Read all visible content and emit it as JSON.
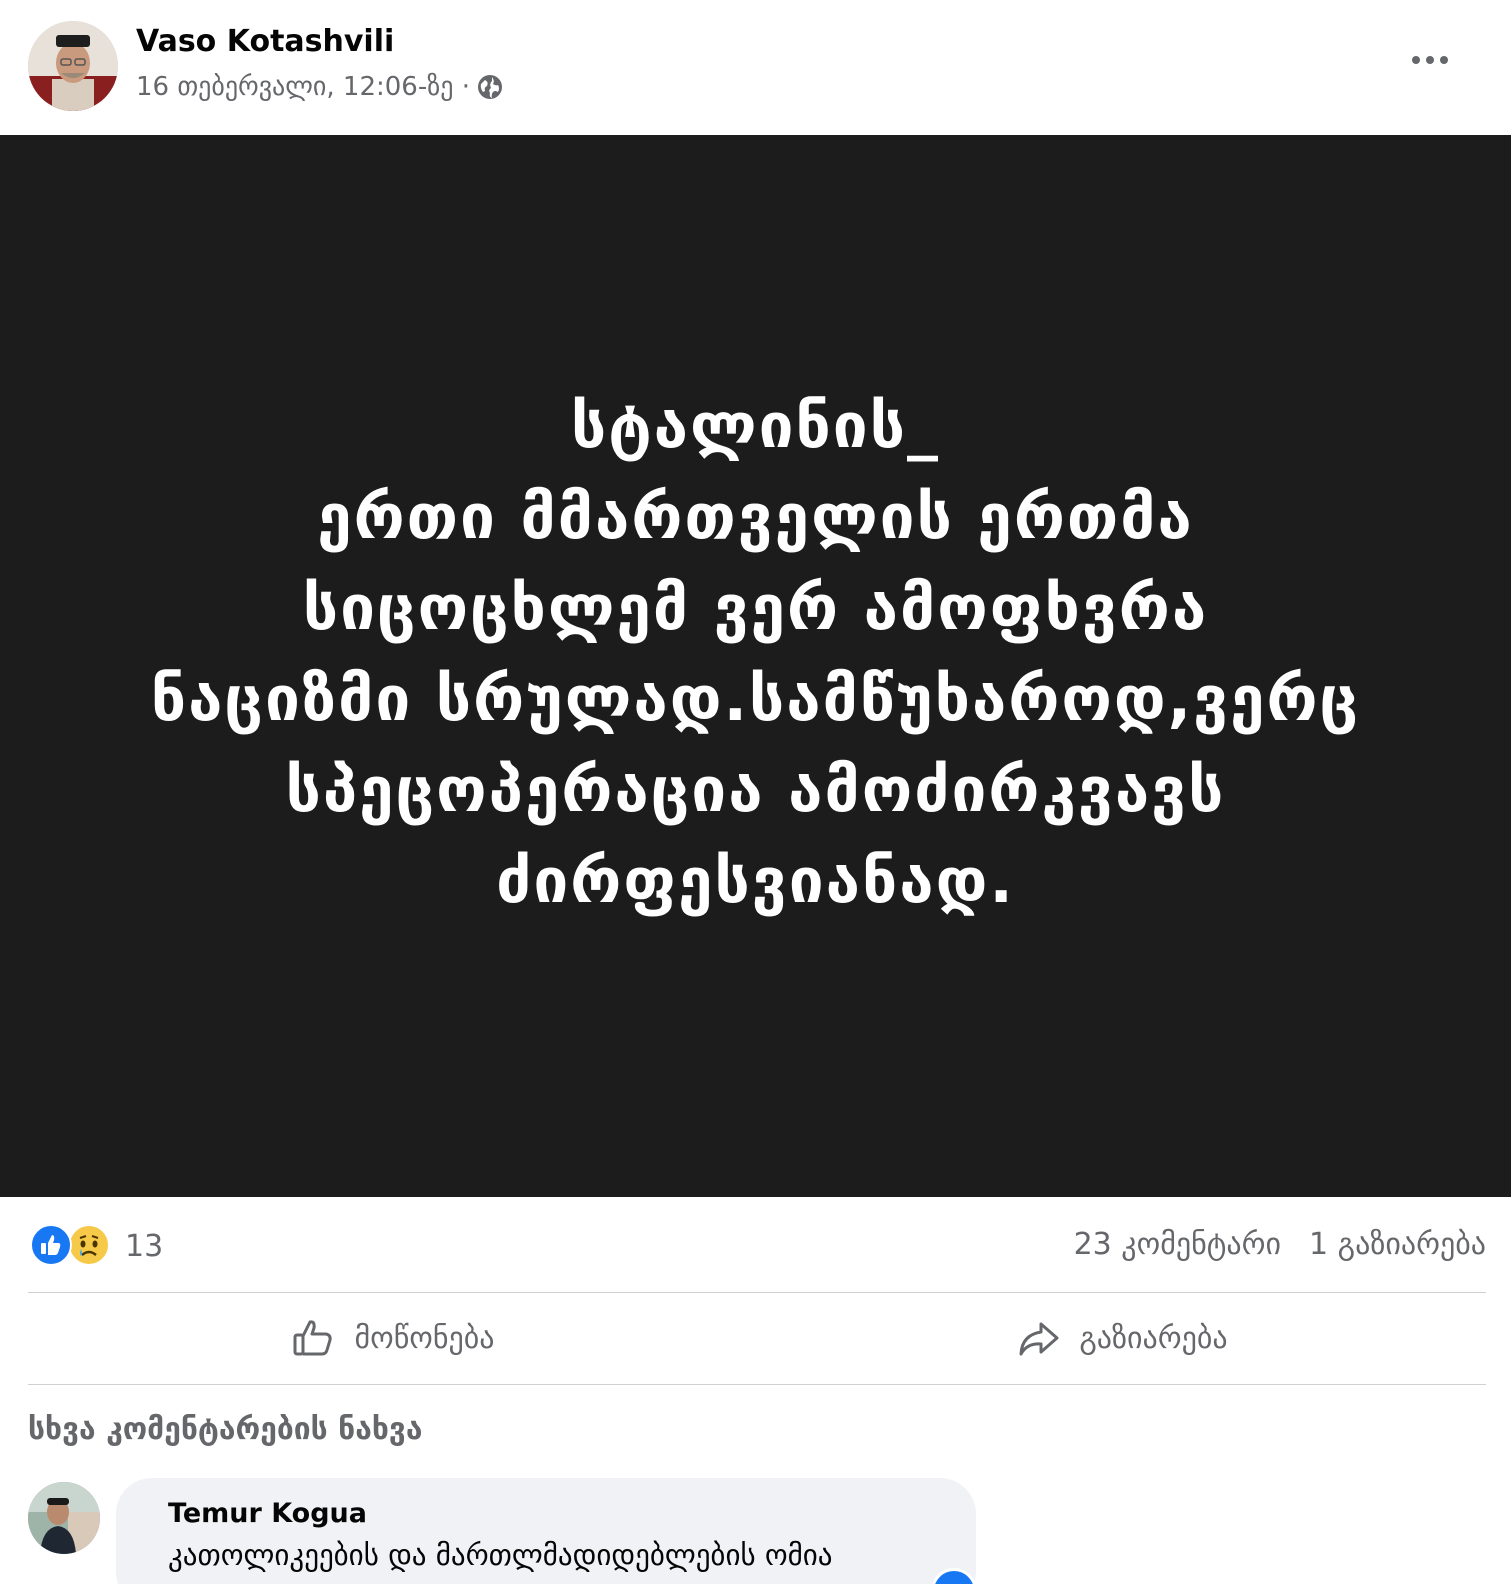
{
  "post": {
    "author": "Vaso Kotashvili",
    "timestamp": "16 თებერვალი, 12:06-ზე ·",
    "privacy_icon": "globe-icon",
    "more_icon": "more-options-icon",
    "image_text": "სტალინის_\nერთი მმართველის ერთმა\nსიცოცხლემ ვერ ამოფხვრა\nნაციზმი სრულად.სამწუხაროდ,ვერც\nსპეცოპერაცია ამოძირკვავს\nძირფესვიანად."
  },
  "reactions": {
    "types": [
      "like",
      "sad"
    ],
    "count": "13",
    "comments": "23 კომენტარი",
    "shares": "1 გაზიარება"
  },
  "actions": {
    "like_label": "მოწონება",
    "share_label": "გაზიარება"
  },
  "comments": {
    "view_more": "სხვა კომენტარების ნახვა",
    "items": [
      {
        "author": "Temur Kogua",
        "text": "კათოლიკეების და მართლმადიდებლების ომია"
      }
    ]
  },
  "colors": {
    "accent": "#1877f2",
    "muted_text": "#65676b",
    "image_bg": "#1c1c1d",
    "bubble_bg": "#f0f2f5"
  }
}
